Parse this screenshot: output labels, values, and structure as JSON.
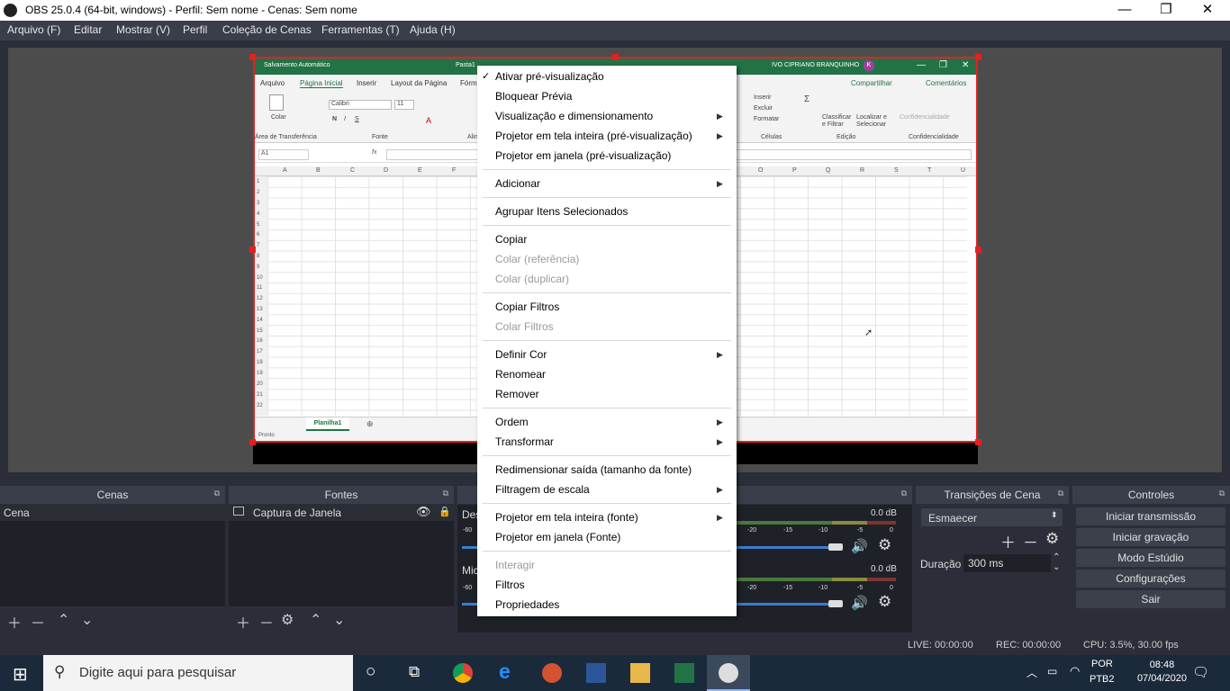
{
  "window": {
    "title": "OBS 25.0.4 (64-bit, windows) - Perfil: Sem nome - Cenas: Sem nome",
    "minimize": "—",
    "maximize": "❐",
    "close": "✕"
  },
  "menubar": {
    "items": [
      "Arquivo (F)",
      "Editar",
      "Mostrar (V)",
      "Perfil",
      "Coleção de Cenas",
      "Ferramentas (T)",
      "Ajuda (H)"
    ]
  },
  "excel": {
    "autosave": "Salvamento Automático",
    "doc": "Pasta1",
    "user": "IVO CIPRIANO BRANQUINHO",
    "avatar_initial": "K",
    "tabs": [
      "Arquivo",
      "Página Inicial",
      "Inserir",
      "Layout da Página",
      "Fórm"
    ],
    "share": "Compartilhar",
    "comments": "Comentários",
    "ribbon": {
      "paste": "Colar",
      "clipboard": "Área de Transferência",
      "font_name": "Calibri",
      "font_size": "11",
      "font_group": "Fonte",
      "align_group": "Alin",
      "insert": "Inserir",
      "delete": "Excluir",
      "format": "Formatar",
      "cells_group": "Células",
      "sort": "Classificar e Filtrar",
      "find": "Localizar e Selecionar",
      "edit_group": "Edição",
      "sensitivity": "Confidencialidade",
      "sensitivity_group": "Confidencialidade"
    },
    "namebox": "A1",
    "fx": "fx",
    "columns_left": [
      "A",
      "B",
      "C",
      "D",
      "E",
      "F"
    ],
    "columns_right": [
      "O",
      "P",
      "Q",
      "R",
      "S",
      "T",
      "U"
    ],
    "rows": [
      "1",
      "2",
      "3",
      "4",
      "5",
      "6",
      "7",
      "8",
      "9",
      "10",
      "11",
      "12",
      "13",
      "14",
      "15",
      "16",
      "17",
      "18",
      "19",
      "20",
      "21",
      "22"
    ],
    "sheet_tab": "Planilha1",
    "status": "Pronto"
  },
  "context_menu": {
    "items": [
      {
        "label": "Ativar pré-visualização",
        "checked": true,
        "disabled": false,
        "submenu": false
      },
      {
        "label": "Bloquear Prévia",
        "disabled": false,
        "submenu": false
      },
      {
        "label": "Visualização e dimensionamento",
        "disabled": false,
        "submenu": true
      },
      {
        "label": "Projetor em tela inteira (pré-visualização)",
        "disabled": false,
        "submenu": true
      },
      {
        "label": "Projetor em janela (pré-visualização)",
        "disabled": false,
        "submenu": false
      },
      {
        "label": "Adicionar",
        "disabled": false,
        "submenu": true
      },
      {
        "label": "Agrupar Itens Selecionados",
        "disabled": false,
        "submenu": false
      },
      {
        "label": "Copiar",
        "disabled": false,
        "submenu": false
      },
      {
        "label": "Colar (referência)",
        "disabled": true,
        "submenu": false
      },
      {
        "label": "Colar (duplicar)",
        "disabled": true,
        "submenu": false
      },
      {
        "label": "Copiar Filtros",
        "disabled": false,
        "submenu": false
      },
      {
        "label": "Colar Filtros",
        "disabled": true,
        "submenu": false
      },
      {
        "label": "Definir Cor",
        "disabled": false,
        "submenu": true
      },
      {
        "label": "Renomear",
        "disabled": false,
        "submenu": false
      },
      {
        "label": "Remover",
        "disabled": false,
        "submenu": false
      },
      {
        "label": "Ordem",
        "disabled": false,
        "submenu": true
      },
      {
        "label": "Transformar",
        "disabled": false,
        "submenu": true
      },
      {
        "label": "Redimensionar saída (tamanho da fonte)",
        "disabled": false,
        "submenu": false
      },
      {
        "label": "Filtragem de escala",
        "disabled": false,
        "submenu": true
      },
      {
        "label": "Projetor em tela inteira (fonte)",
        "disabled": false,
        "submenu": true
      },
      {
        "label": "Projetor em janela (Fonte)",
        "disabled": false,
        "submenu": false
      },
      {
        "label": "Interagir",
        "disabled": true,
        "submenu": false
      },
      {
        "label": "Filtros",
        "disabled": false,
        "submenu": false
      },
      {
        "label": "Propriedades",
        "disabled": false,
        "submenu": false
      }
    ],
    "check_glyph": "✓",
    "submenu_glyph": "▶"
  },
  "docks": {
    "scenes": {
      "title": "Cenas",
      "items": [
        "Cena"
      ]
    },
    "sources": {
      "title": "Fontes",
      "items": [
        "Captura de Janela"
      ]
    },
    "mixer": {
      "channels": [
        {
          "name": "Des",
          "db": "0.0 dB"
        },
        {
          "name": "Mic/",
          "db": "0.0 dB"
        }
      ],
      "scale": [
        "-60",
        "-20",
        "-15",
        "-10",
        "-5",
        "0"
      ]
    },
    "transitions": {
      "title": "Transições de Cena",
      "selected": "Esmaecer",
      "duration_label": "Duração",
      "duration_value": "300 ms"
    },
    "controls": {
      "title": "Controles",
      "buttons": [
        "Iniciar transmissão",
        "Iniciar gravação",
        "Modo Estúdio",
        "Configurações",
        "Sair"
      ]
    }
  },
  "statusbar": {
    "live": "LIVE: 00:00:00",
    "rec": "REC: 00:00:00",
    "cpu": "CPU: 3.5%, 30.00 fps"
  },
  "taskbar": {
    "search_placeholder": "Digite aqui para pesquisar",
    "lang1": "POR",
    "lang2": "PTB2",
    "time": "08:48",
    "date": "07/04/2020"
  },
  "colors": {
    "selection_red": "#e52020",
    "excel_green": "#217346",
    "obs_bg": "#2b2e38",
    "taskbar": "#1b2a3a"
  }
}
